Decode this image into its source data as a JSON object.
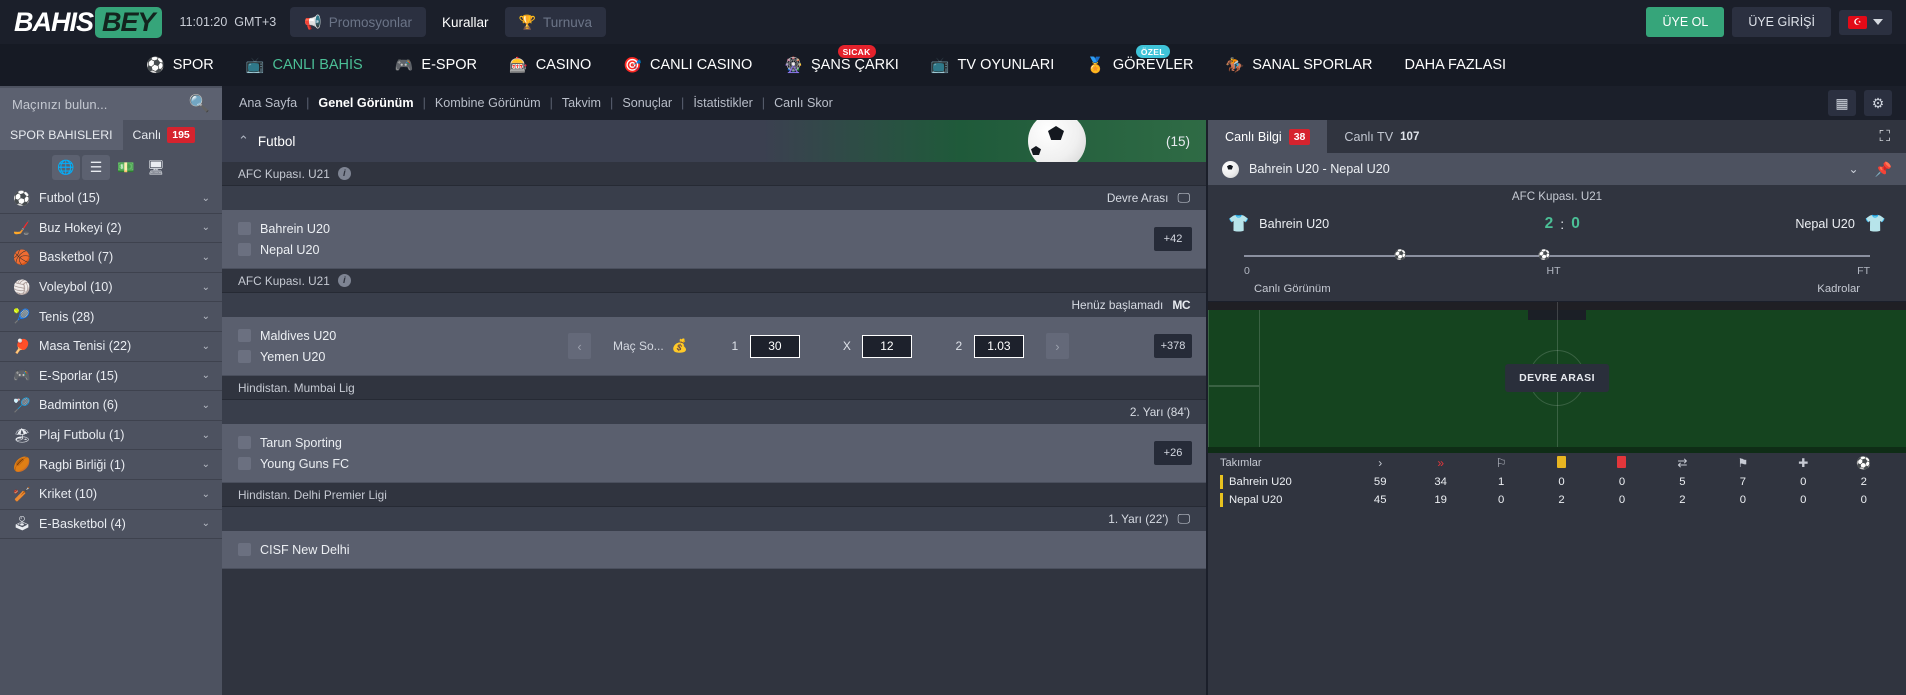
{
  "header": {
    "logo_bahis": "BAHIS",
    "logo_bey": "BEY",
    "clock": "11:01:20",
    "timezone": "GMT+3",
    "promotions": "Promosyonlar",
    "rules": "Kurallar",
    "tournament": "Turnuva",
    "signup": "ÜYE OL",
    "login": "ÜYE GİRİŞİ",
    "lang_flag": "TR"
  },
  "mainnav": [
    {
      "label": "SPOR",
      "icon": "soccer-ball-icon",
      "style": "white",
      "badge": ""
    },
    {
      "label": "CANLI BAHİS",
      "icon": "live-icon",
      "style": "teal",
      "badge": ""
    },
    {
      "label": "E-SPOR",
      "icon": "gamepad-icon",
      "style": "white",
      "badge": ""
    },
    {
      "label": "CASINO",
      "icon": "casino-icon",
      "style": "white",
      "badge": ""
    },
    {
      "label": "CANLI CASINO",
      "icon": "live-casino-icon",
      "style": "white",
      "badge": ""
    },
    {
      "label": "ŞANS ÇARKI",
      "icon": "wheel-icon",
      "style": "white",
      "badge": "SICAK",
      "badge_kind": "hot"
    },
    {
      "label": "TV OYUNLARI",
      "icon": "tv-icon",
      "style": "white",
      "badge": ""
    },
    {
      "label": "GÖREVLER",
      "icon": "trophy-person-icon",
      "style": "white",
      "badge": "ÖZEL",
      "badge_kind": "ozel"
    },
    {
      "label": "SANAL SPORLAR",
      "icon": "virtual-icon",
      "style": "white",
      "badge": ""
    },
    {
      "label": "DAHA FAZLASI",
      "icon": "",
      "style": "white",
      "badge": ""
    }
  ],
  "breadcrumb": {
    "items": [
      {
        "label": "Ana Sayfa",
        "active": false
      },
      {
        "label": "Genel Görünüm",
        "active": true
      },
      {
        "label": "Kombine Görünüm",
        "active": false
      },
      {
        "label": "Takvim",
        "active": false
      },
      {
        "label": "Sonuçlar",
        "active": false
      },
      {
        "label": "İstatistikler",
        "active": false
      },
      {
        "label": "Canlı Skor",
        "active": false
      }
    ],
    "separator": "|",
    "calculator_icon": "calculator-icon",
    "settings_icon": "gear-icon"
  },
  "sidebar": {
    "search_placeholder": "Maçınızı bulun...",
    "search_value": "",
    "tab_sports": "SPOR BAHISLERI",
    "tab_live": "Canlı",
    "live_count": "195",
    "view_buttons": [
      "globe-icon",
      "list-icon",
      "cash-icon",
      "monitor-icon"
    ],
    "sports": [
      {
        "emoji": "⚽",
        "label": "Futbol (15)",
        "name": "futbol"
      },
      {
        "emoji": "🏒",
        "label": "Buz Hokeyi (2)",
        "name": "buz-hokeyi"
      },
      {
        "emoji": "🏀",
        "label": "Basketbol (7)",
        "name": "basketbol"
      },
      {
        "emoji": "🏐",
        "label": "Voleybol (10)",
        "name": "voleybol"
      },
      {
        "emoji": "🎾",
        "label": "Tenis (28)",
        "name": "tenis"
      },
      {
        "emoji": "🏓",
        "label": "Masa Tenisi (22)",
        "name": "masa-tenisi"
      },
      {
        "emoji": "🎮",
        "label": "E-Sporlar (15)",
        "name": "e-sporlar"
      },
      {
        "emoji": "🏸",
        "label": "Badminton (6)",
        "name": "badminton"
      },
      {
        "emoji": "🏖",
        "label": "Plaj Futbolu (1)",
        "name": "plaj-futbolu"
      },
      {
        "emoji": "🏉",
        "label": "Ragbi Birliği (1)",
        "name": "ragbi-birligi"
      },
      {
        "emoji": "🏏",
        "label": "Kriket (10)",
        "name": "kriket"
      },
      {
        "emoji": "🕹",
        "label": "E-Basketbol (4)",
        "name": "e-basketbol"
      }
    ]
  },
  "center": {
    "banner_title": "Futbol",
    "banner_count": "(15)",
    "groups": [
      {
        "league": "AFC Kupası. U21",
        "status": "Devre Arası",
        "status_icon": "tv-icon",
        "home": "Bahrein U20",
        "away": "Nepal U20",
        "plus": "+42",
        "has_odds": false,
        "market": "",
        "odds": []
      },
      {
        "league": "AFC Kupası. U21",
        "status": "Henüz başlamadı",
        "status_icon": "mc-icon",
        "home": "Maldives U20",
        "away": "Yemen U20",
        "plus": "+378",
        "has_odds": true,
        "market": "Maç So...",
        "odds": [
          {
            "label": "1",
            "value": "30"
          },
          {
            "label": "X",
            "value": "12"
          },
          {
            "label": "2",
            "value": "1.03"
          }
        ]
      },
      {
        "league": "Hindistan. Mumbai Lig",
        "status": "2. Yarı  (84')",
        "status_icon": "",
        "home": "Tarun Sporting",
        "away": "Young Guns FC",
        "plus": "+26",
        "has_odds": false,
        "market": "",
        "odds": []
      },
      {
        "league": "Hindistan. Delhi Premier Ligi",
        "status": "1. Yarı  (22')",
        "status_icon": "tv-icon",
        "home": "CISF New Delhi",
        "away": "",
        "plus": "",
        "has_odds": false,
        "market": "",
        "odds": []
      }
    ]
  },
  "right_panel": {
    "tab_live_info": "Canlı Bilgi",
    "tab_live_info_count": "38",
    "tab_live_tv": "Canlı TV",
    "tab_live_tv_count": "107",
    "expand_icon": "expand-icon",
    "match_title": "Bahrein U20 - Nepal U20",
    "chevron_icon": "chevron-down-icon",
    "pin_icon": "pin-icon",
    "league": "AFC Kupası. U21",
    "home_team": "Bahrein U20",
    "away_team": "Nepal U20",
    "home_score": "2",
    "away_score": "0",
    "score_separator": ":",
    "timeline_labels": [
      "0",
      "HT",
      "FT"
    ],
    "timeline_sub": [
      "Canlı Görünüm",
      "Kadrolar"
    ],
    "pitch_status": "DEVRE ARASI",
    "stats": {
      "header_label": "Takımlar",
      "header_icons": [
        "attack-icon",
        "dangerous-attack-icon",
        "shot-icon",
        "yellow-card-icon",
        "red-card-icon",
        "substitution-icon",
        "offside-icon",
        "corner-icon"
      ],
      "rows": [
        {
          "team": "Bahrein U20",
          "values": [
            "59",
            "34",
            "1",
            "0",
            "0",
            "5",
            "7",
            "0",
            "2"
          ]
        },
        {
          "team": "Nepal U20",
          "values": [
            "45",
            "19",
            "0",
            "2",
            "0",
            "2",
            "0",
            "0",
            "0"
          ]
        }
      ]
    }
  }
}
